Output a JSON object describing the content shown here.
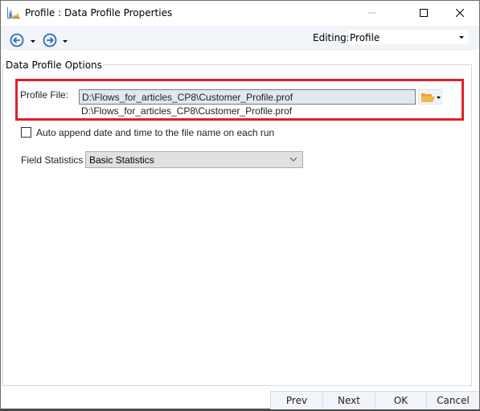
{
  "window": {
    "title": "Profile : Data Profile Properties",
    "controls": {
      "minimize": "minimize",
      "maximize": "maximize",
      "close": "close"
    }
  },
  "toolbar": {
    "back_icon": "back-arrow-circle",
    "forward_icon": "forward-arrow-circle",
    "editing_label": "Editing:",
    "editing_value": "Profile"
  },
  "group": {
    "title": "Data Profile Options",
    "profile_file_label": "Profile File:",
    "profile_file_value": "D:\\Flows_for_articles_CP8\\Customer_Profile.prof",
    "profile_file_resolved": "D:\\Flows_for_articles_CP8\\Customer_Profile.prof",
    "browse_icon": "folder-open",
    "auto_append_label": "Auto append date and time to the file name on each run",
    "auto_append_checked": false,
    "field_stats_label": "Field Statistics :",
    "field_stats_value": "Basic Statistics"
  },
  "highlight_color": "#e0202a",
  "footer": {
    "prev": "Prev",
    "next": "Next",
    "ok": "OK",
    "cancel": "Cancel"
  }
}
